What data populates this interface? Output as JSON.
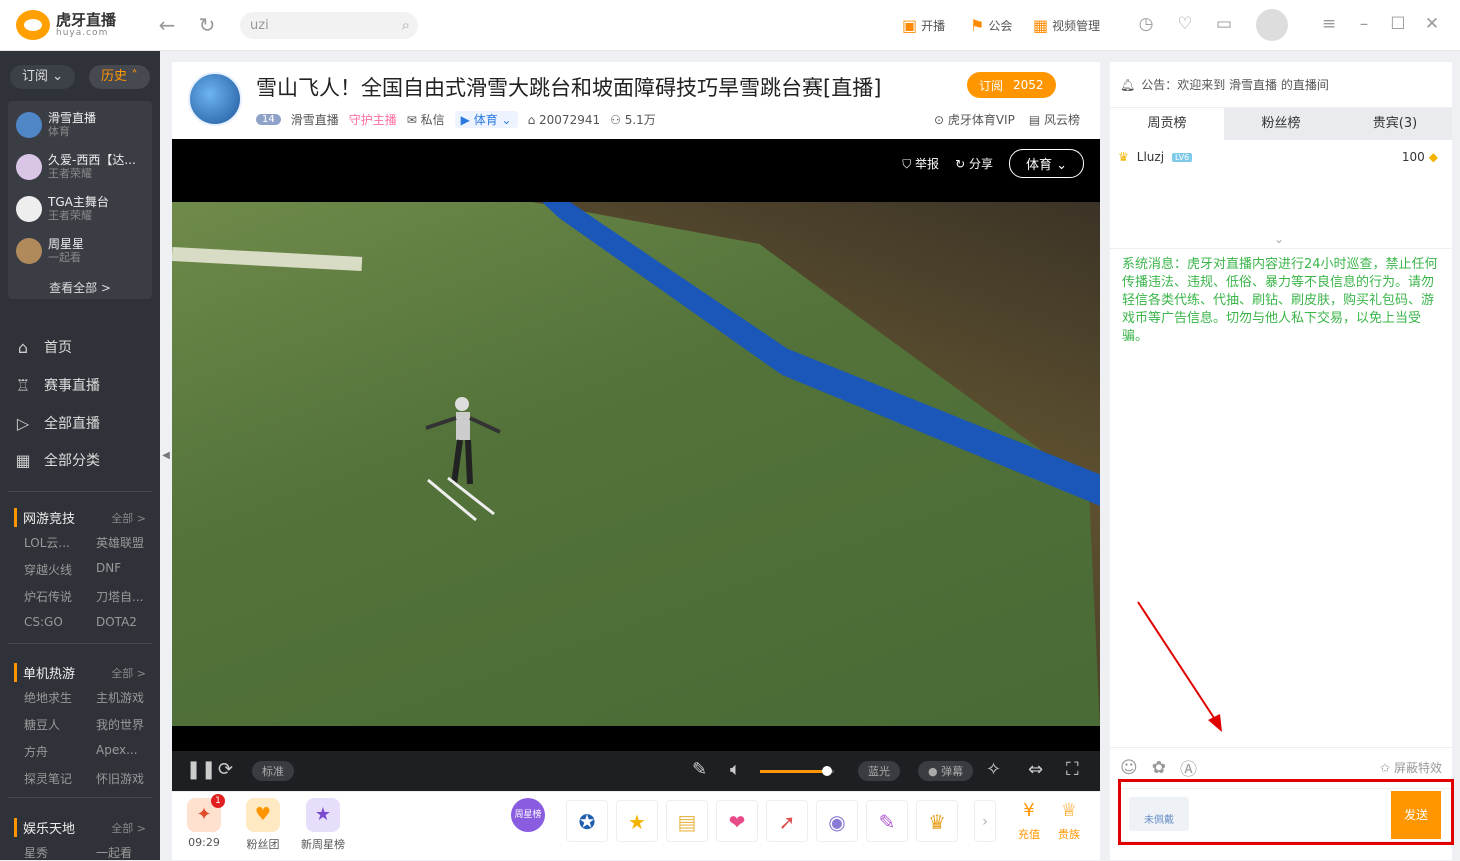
{
  "app": {
    "logo_cn": "虎牙直播",
    "logo_en": "huya.com"
  },
  "topbar": {
    "search_value": "uzi",
    "links": [
      {
        "icon": "broadcast-icon",
        "label": "开播"
      },
      {
        "icon": "flag-icon",
        "label": "公会"
      },
      {
        "icon": "video-manage-icon",
        "label": "视频管理"
      }
    ]
  },
  "sidebar": {
    "tabs": [
      "订阅",
      "历史"
    ],
    "history": [
      {
        "name": "滑雪直播",
        "game": "体育"
      },
      {
        "name": "久爱-西西【达...",
        "game": "王者荣耀"
      },
      {
        "name": "TGA主舞台",
        "game": "王者荣耀"
      },
      {
        "name": "周星星",
        "game": "一起看"
      }
    ],
    "see_all": "查看全部 >",
    "nav": [
      {
        "icon": "home-icon",
        "label": "首页"
      },
      {
        "icon": "trophy-icon",
        "label": "赛事直播"
      },
      {
        "icon": "play-icon",
        "label": "全部直播"
      },
      {
        "icon": "grid-icon",
        "label": "全部分类"
      }
    ],
    "sections": [
      {
        "title": "网游竞技",
        "all": "全部 >",
        "items": [
          "LOL云...",
          "英雄联盟",
          "穿越火线",
          "DNF",
          "炉石传说",
          "刀塔自...",
          "CS:GO",
          "DOTA2"
        ]
      },
      {
        "title": "单机热游",
        "all": "全部 >",
        "items": [
          "绝地求生",
          "主机游戏",
          "糖豆人",
          "我的世界",
          "方舟",
          "Apex...",
          "探灵笔记",
          "怀旧游戏"
        ]
      },
      {
        "title": "娱乐天地",
        "all": "全部 >",
        "items": [
          "星秀",
          "一起看"
        ]
      }
    ]
  },
  "stream": {
    "title": "雪山飞人！全国自由式滑雪大跳台和坡面障碍技巧旱雪跳台赛[直播]",
    "subscribe_label": "订阅",
    "subscribe_count": "2052",
    "level": "14",
    "anchor": "滑雪直播",
    "guard": "守护主播",
    "message": "私信",
    "category": "体育",
    "room_id": "20072941",
    "viewers": "5.1万",
    "vip": "虎牙体育VIP",
    "rank": "风云榜"
  },
  "video": {
    "report": "举报",
    "share": "分享",
    "category_btn": "体育",
    "quality": "标准",
    "bluray": "蓝光",
    "danmaku": "弹幕",
    "volume": 0.9
  },
  "gifts": {
    "chest_time": "09:29",
    "chest_badge": "1",
    "fans_group": "粉丝团",
    "weekly_star": "新周星榜",
    "weekly_star_badge": "周星榜",
    "recharge": "充值",
    "noble": "贵族"
  },
  "panel": {
    "notice": "公告：欢迎来到 滑雪直播 的直播间",
    "tabs": [
      "周贡榜",
      "粉丝榜",
      "贵宾(3)"
    ],
    "rank_user": "Lluzj",
    "rank_badge": "LV6",
    "rank_score": "100",
    "system_msg": "系统消息：虎牙对直播内容进行24小时巡查，禁止任何传播违法、违规、低俗、暴力等不良信息的行为。请勿轻信各类代练、代抽、刷钻、刷皮肤，购买礼包码、游戏币等广告信息。切勿与他人私下交易，以免上当受骗。",
    "block_effects": "屏蔽特效",
    "not_wearing": "未佩戴",
    "send": "发送"
  },
  "colors": {
    "accent": "#ff9600",
    "sidebar_bg": "#2f3238",
    "system_green": "#3bb54a",
    "highlight_red": "#e00000"
  }
}
